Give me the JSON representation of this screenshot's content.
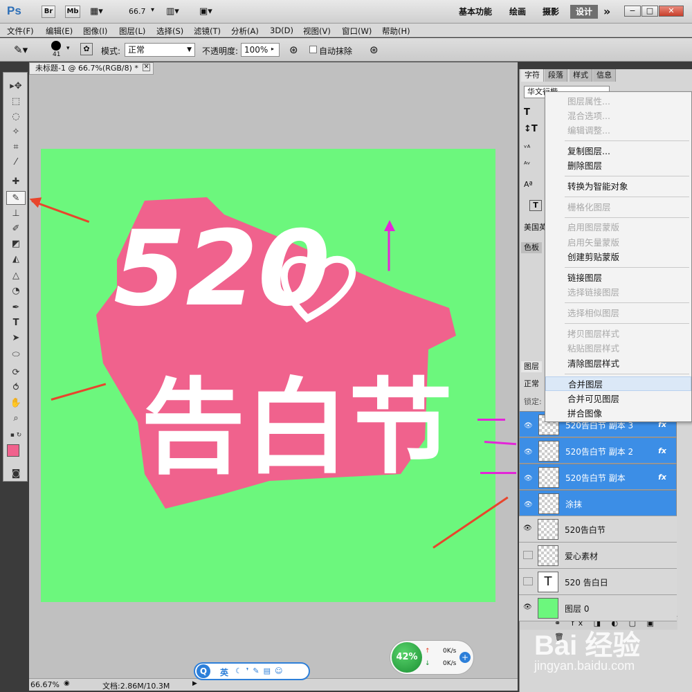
{
  "app": {
    "logo": "Ps",
    "br": "Br",
    "mb": "Mb",
    "zoom": "66.7",
    "workspaces": [
      "基本功能",
      "绘画",
      "摄影",
      "设计"
    ],
    "more": "»",
    "win_min": "−",
    "win_max": "□",
    "win_close": "✕"
  },
  "menu": [
    "文件(F)",
    "编辑(E)",
    "图像(I)",
    "图层(L)",
    "选择(S)",
    "滤镜(T)",
    "分析(A)",
    "3D(D)",
    "视图(V)",
    "窗口(W)",
    "帮助(H)"
  ],
  "options": {
    "brush_size": "41",
    "mode_label": "模式:",
    "mode_value": "正常",
    "opacity_label": "不透明度:",
    "opacity_value": "100%",
    "auto_erase_label": "自动抹除"
  },
  "document": {
    "tab_title": "未标题-1 @ 66.7%(RGB/8) *",
    "tab_close": "✕",
    "canvas_color": "#6cf77d",
    "artwork_text_top": "520",
    "artwork_text_bottom": "告白节"
  },
  "status": {
    "zoom": "66.67%",
    "doc_size": "文档:2.86M/10.3M"
  },
  "panels": {
    "char_tabs": [
      "字符",
      "段落",
      "样式",
      "信息"
    ],
    "font_family": "华文行楷",
    "language": "美国英",
    "swatches_tab": "色板",
    "layers_tab": "图层",
    "blend_mode": "正常",
    "lock_label": "锁定:"
  },
  "layers": [
    {
      "name": "520告白节 副本 3",
      "visible": true,
      "selected": true,
      "fx": true,
      "type": "raster"
    },
    {
      "name": "520告白节 副本 2",
      "visible": true,
      "selected": true,
      "fx": true,
      "type": "raster"
    },
    {
      "name": "520告白节 副本",
      "visible": true,
      "selected": true,
      "fx": true,
      "type": "raster"
    },
    {
      "name": "涂抹",
      "visible": true,
      "selected": true,
      "fx": false,
      "type": "raster"
    },
    {
      "name": "520告白节",
      "visible": true,
      "selected": false,
      "fx": false,
      "type": "raster"
    },
    {
      "name": "爱心素材",
      "visible": false,
      "selected": false,
      "fx": false,
      "type": "raster"
    },
    {
      "name": "520    告白日",
      "visible": false,
      "selected": false,
      "fx": false,
      "type": "text"
    },
    {
      "name": "图层 0",
      "visible": true,
      "selected": false,
      "fx": false,
      "type": "fill"
    }
  ],
  "context_menu": [
    {
      "label": "图层属性...",
      "disabled": true
    },
    {
      "label": "混合选项...",
      "disabled": true
    },
    {
      "label": "编辑调整...",
      "disabled": true
    },
    {
      "label": "复制图层...",
      "disabled": false
    },
    {
      "label": "删除图层",
      "disabled": false
    },
    {
      "label": "转换为智能对象",
      "disabled": false
    },
    {
      "label": "栅格化图层",
      "disabled": true
    },
    {
      "label": "启用图层蒙版",
      "disabled": true
    },
    {
      "label": "启用矢量蒙版",
      "disabled": true
    },
    {
      "label": "创建剪贴蒙版",
      "disabled": false
    },
    {
      "label": "链接图层",
      "disabled": false
    },
    {
      "label": "选择链接图层",
      "disabled": true
    },
    {
      "label": "选择相似图层",
      "disabled": true
    },
    {
      "label": "拷贝图层样式",
      "disabled": true
    },
    {
      "label": "粘贴图层样式",
      "disabled": true
    },
    {
      "label": "清除图层样式",
      "disabled": false
    },
    {
      "label": "合并图层",
      "disabled": false,
      "hover": true
    },
    {
      "label": "合并可见图层",
      "disabled": false
    },
    {
      "label": "拼合图像",
      "disabled": false
    }
  ],
  "ime": {
    "lang": "英"
  },
  "network": {
    "percent": "42%",
    "up": "0K/s",
    "down": "0K/s"
  },
  "watermark": {
    "brand": "Bai 经验",
    "url": "jingyan.baidu.com"
  },
  "colors": {
    "accent": "#3c8ee6",
    "pink": "#f0628d",
    "green": "#6cf77d",
    "red_arrow": "#e8452c",
    "magenta_arrow": "#e325d8"
  }
}
